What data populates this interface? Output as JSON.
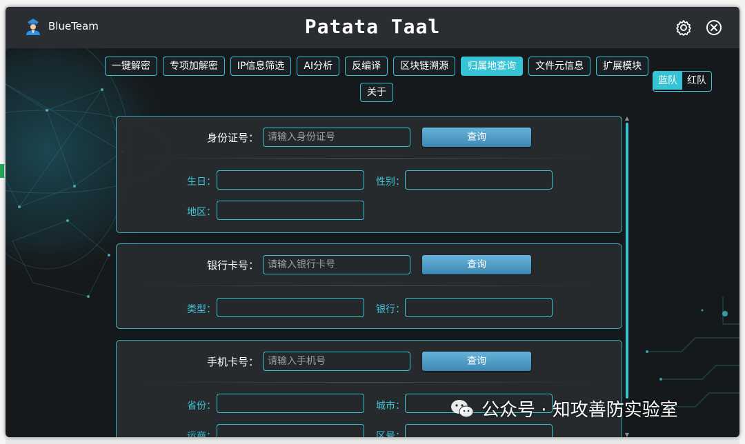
{
  "titlebar": {
    "brand": "BlueTeam",
    "title": "Patata Taal",
    "settings_icon": "gear-icon",
    "close_icon": "close-circle-icon"
  },
  "nav": {
    "items": [
      {
        "label": "一键解密",
        "active": false
      },
      {
        "label": "专项加解密",
        "active": false
      },
      {
        "label": "IP信息筛选",
        "active": false
      },
      {
        "label": "AI分析",
        "active": false
      },
      {
        "label": "反编译",
        "active": false
      },
      {
        "label": "区块链溯源",
        "active": false
      },
      {
        "label": "归属地查询",
        "active": true
      },
      {
        "label": "文件元信息",
        "active": false
      },
      {
        "label": "扩展模块",
        "active": false
      },
      {
        "label": "关于",
        "active": false
      }
    ]
  },
  "team_toggle": {
    "blue": "蓝队",
    "red": "红队",
    "selected": "蓝队"
  },
  "id_section": {
    "label": "身份证号：",
    "placeholder": "请输入身份证号",
    "query": "查询",
    "fields": {
      "birthday": "生日：",
      "gender": "性别：",
      "region": "地区："
    }
  },
  "bank_section": {
    "label": "银行卡号：",
    "placeholder": "请输入银行卡号",
    "query": "查询",
    "fields": {
      "type": "类型：",
      "bank": "银行："
    }
  },
  "phone_section": {
    "label": "手机卡号：",
    "placeholder": "请输入手机号",
    "query": "查询",
    "fields": {
      "province": "省份：",
      "city": "城市：",
      "carrier": "运商：",
      "area_code": "区号："
    }
  },
  "watermark": "公众号 · 知攻善防实验室",
  "colors": {
    "accent": "#37c3d6",
    "button": "#4f9ccb",
    "background": "#1c2023"
  }
}
